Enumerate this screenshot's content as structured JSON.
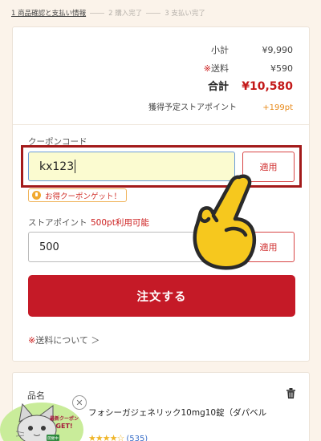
{
  "steps": [
    {
      "label": "1 商品確認と支払い情報"
    },
    {
      "label": "2 購入完了"
    },
    {
      "label": "3 支払い完了"
    }
  ],
  "summary": {
    "subtotal_label": "小計",
    "subtotal_value": "¥9,990",
    "shipping_mark": "※",
    "shipping_label": "送料",
    "shipping_value": "¥590",
    "total_label": "合計",
    "total_value": "¥10,580",
    "points_label": "獲得予定ストアポイント",
    "points_value": "+199pt"
  },
  "coupon": {
    "label": "クーポンコード",
    "value": "kx123",
    "apply_label": "適用",
    "deal_label": "お得クーポンゲット！"
  },
  "store_points": {
    "label": "ストアポイント",
    "available": "500pt利用可能",
    "value": "500",
    "apply_label": "適用"
  },
  "order_button": "注文する",
  "shipping_link": {
    "mark": "※",
    "text": "送料について ＞"
  },
  "product": {
    "section_label": "品名",
    "name": "フォシーガジェネリック10mg10錠（ダパベル",
    "rating": 4.5,
    "stars": "★★★★☆",
    "review_count": "(535)"
  },
  "badge": {
    "line1": "最新クーポン",
    "line2": "GET!",
    "tag": "開催中"
  },
  "icons": {
    "hand": "pointing-hand-icon",
    "trash": "trash-icon",
    "close": "close-icon",
    "bulb": "bulb-icon"
  },
  "colors": {
    "accent_red": "#c51a27",
    "highlight_frame": "#a31a1a",
    "points_orange": "#e88a1a",
    "star_gold": "#f0b62a"
  }
}
